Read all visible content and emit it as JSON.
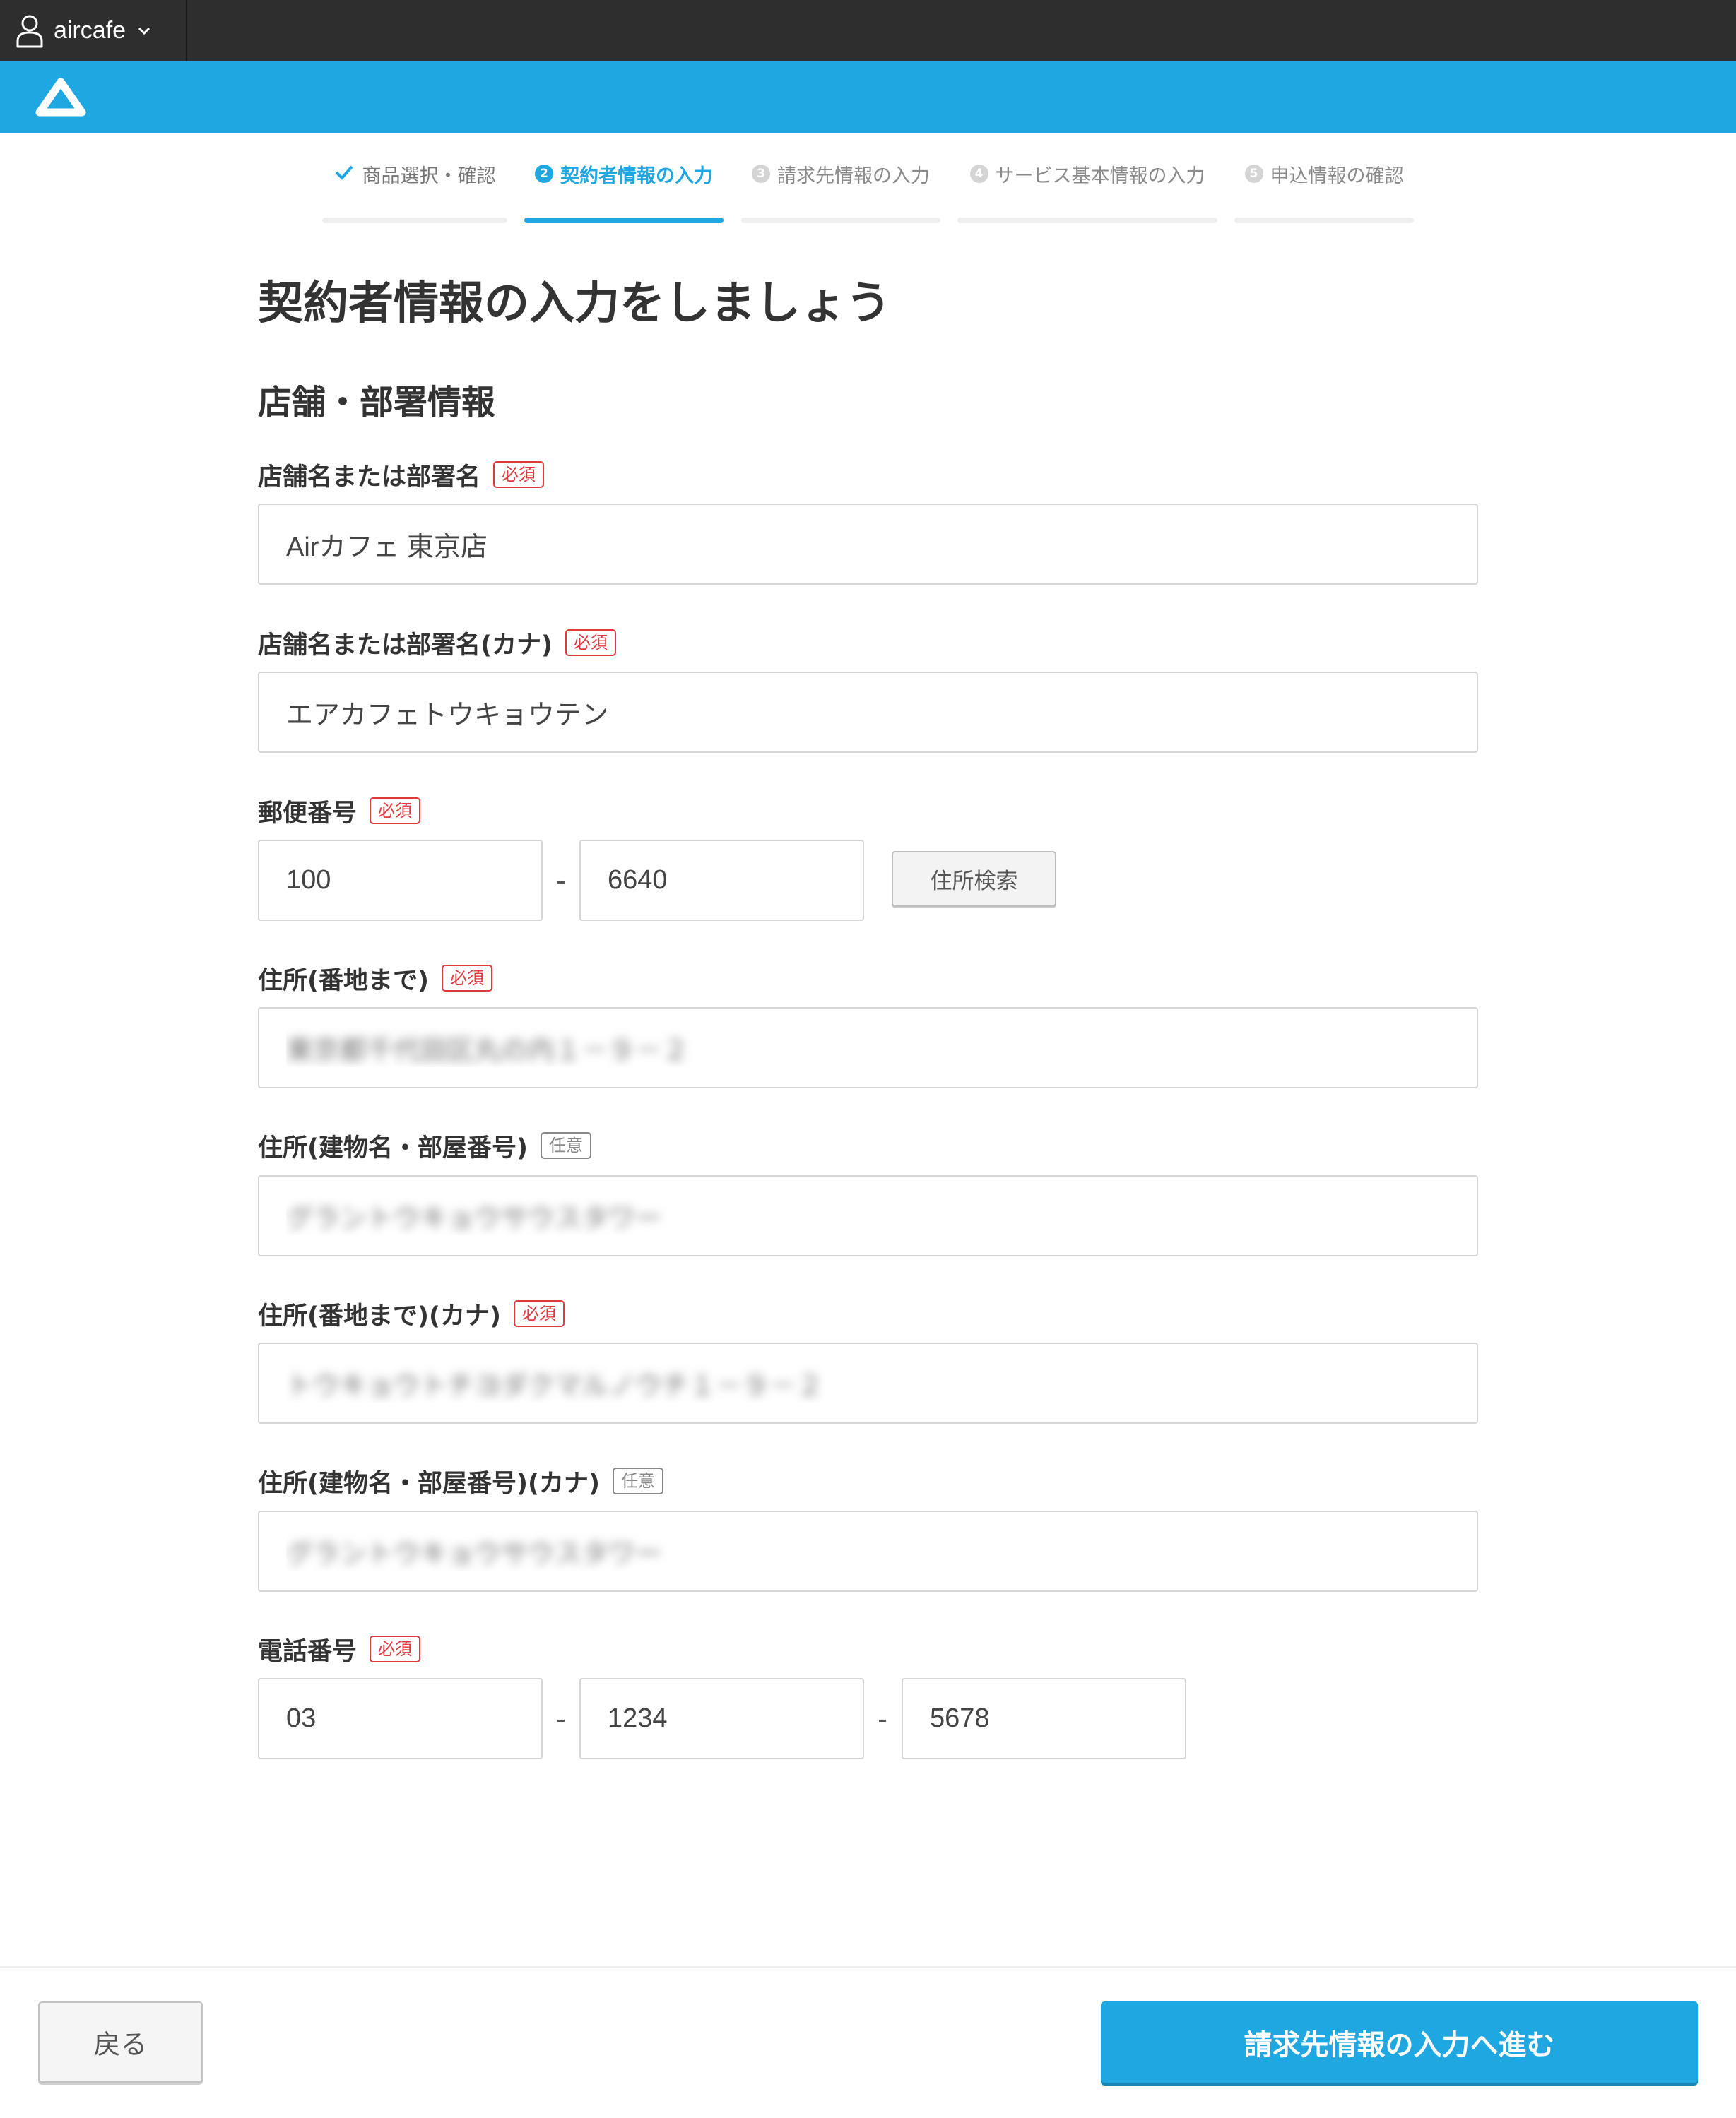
{
  "account": {
    "name": "aircafe",
    "icon": "user-icon"
  },
  "brand": {
    "logo": "air-triangle-logo"
  },
  "colors": {
    "accent": "#1ea7e1",
    "required": "#e0393e",
    "topbar": "#2e2e2e"
  },
  "stepper": {
    "steps": [
      {
        "label": "商品選択・確認",
        "state": "done"
      },
      {
        "num": "2",
        "label": "契約者情報の入力",
        "state": "active"
      },
      {
        "num": "3",
        "label": "請求先情報の入力",
        "state": "todo"
      },
      {
        "num": "4",
        "label": "サービス基本情報の入力",
        "state": "todo"
      },
      {
        "num": "5",
        "label": "申込情報の確認",
        "state": "todo"
      }
    ]
  },
  "page": {
    "title": "契約者情報の入力をしましょう",
    "section_title": "店舗・部署情報"
  },
  "badges": {
    "required": "必須",
    "optional": "任意"
  },
  "form": {
    "store_name": {
      "label": "店舗名または部署名",
      "value": "Airカフェ 東京店"
    },
    "store_name_kana": {
      "label": "店舗名または部署名(カナ)",
      "value": "エアカフェトウキョウテン"
    },
    "postal": {
      "label": "郵便番号",
      "part1": "100",
      "part2": "6640",
      "sep": "-",
      "search_label": "住所検索"
    },
    "address1": {
      "label": "住所(番地まで)",
      "value": "東京都千代田区丸の内１－９－２"
    },
    "address2": {
      "label": "住所(建物名・部屋番号)",
      "value": "グラントウキョウサウスタワー"
    },
    "address1_kana": {
      "label": "住所(番地まで)(カナ)",
      "value": "トウキョウトチヨダクマルノウチ１－９－２"
    },
    "address2_kana": {
      "label": "住所(建物名・部屋番号)(カナ)",
      "value": "グラントウキョウサウスタワー"
    },
    "phone": {
      "label": "電話番号",
      "part1": "03",
      "part2": "1234",
      "part3": "5678",
      "sep": "-"
    }
  },
  "footer": {
    "back_label": "戻る",
    "next_label": "請求先情報の入力へ進む"
  }
}
